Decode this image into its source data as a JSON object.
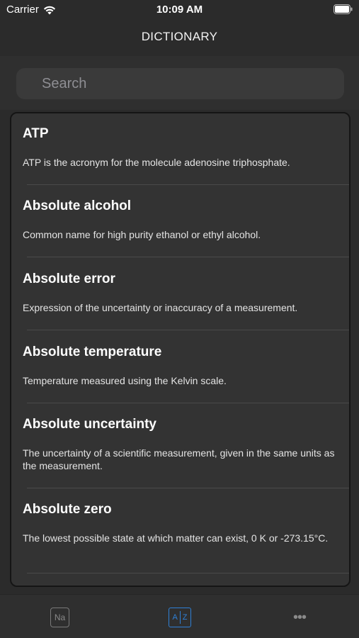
{
  "status_bar": {
    "carrier": "Carrier",
    "time": "10:09 AM"
  },
  "nav": {
    "title": "DICTIONARY"
  },
  "search": {
    "placeholder": "Search"
  },
  "entries": [
    {
      "term": "ATP",
      "definition": "ATP is the acronym for the molecule adenosine triphosphate."
    },
    {
      "term": "Absolute alcohol",
      "definition": "Common name for high purity ethanol or ethyl alcohol."
    },
    {
      "term": "Absolute error",
      "definition": "Expression of the uncertainty or inaccuracy of a measurement."
    },
    {
      "term": "Absolute temperature",
      "definition": "Temperature measured using the Kelvin scale."
    },
    {
      "term": "Absolute uncertainty",
      "definition": "The uncertainty of a scientific measurement, given in the same units as the measurement."
    },
    {
      "term": "Absolute zero",
      "definition": "The lowest possible state at which matter can exist, 0 K or -273.15°C."
    }
  ],
  "tab_bar": {
    "elements_label": "Na",
    "dictionary_label_a": "A",
    "dictionary_label_z": "Z",
    "more_label": "•••",
    "active_tab": "dictionary",
    "active_color": "#2f80d6",
    "inactive_color": "#8a8a8a"
  }
}
